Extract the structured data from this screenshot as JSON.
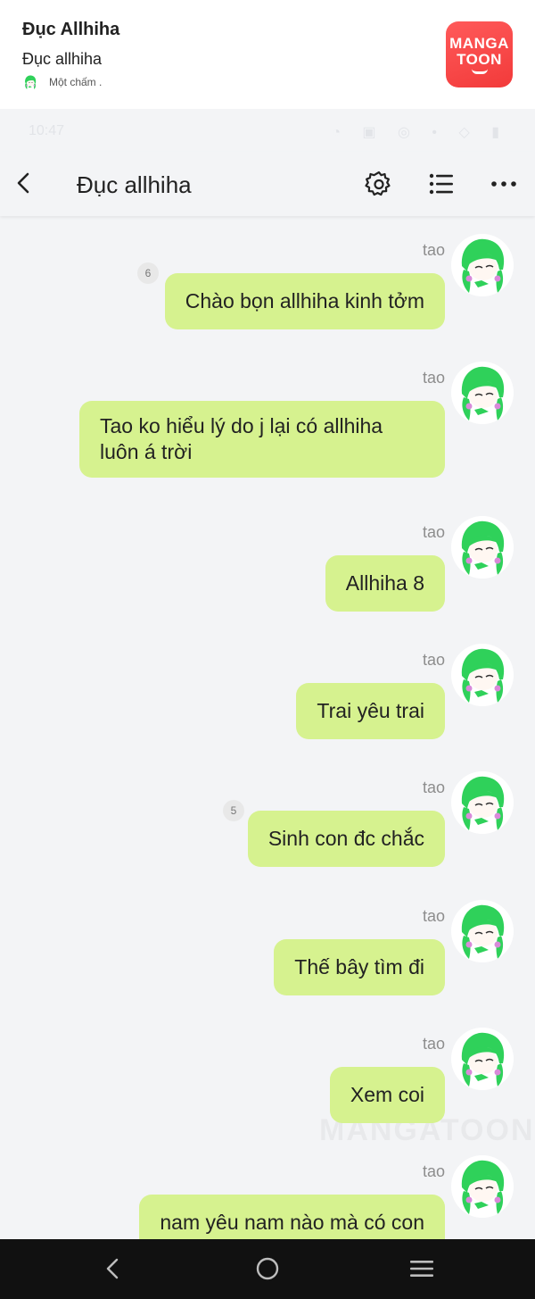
{
  "story": {
    "title": "Đục Allhiha",
    "subtitle": "Đục allhiha",
    "meta": "Một chấm ."
  },
  "logo": {
    "line1": "MANGA",
    "line2": "TOON"
  },
  "status_bar": {
    "time": "10:47",
    "icons": "◔ ▣ ◎ • ◇ ▮"
  },
  "app_bar": {
    "title": "Đục allhiha"
  },
  "watermark": "MANGATOON",
  "messages": [
    {
      "sender": "tao",
      "text": "Chào bọn allhiha kinh tởm",
      "badge": "6"
    },
    {
      "sender": "tao",
      "text": "Tao ko hiểu lý do j lại có allhiha\nluôn á trời",
      "badge": ""
    },
    {
      "sender": "tao",
      "text": "Allhiha 8",
      "badge": ""
    },
    {
      "sender": "tao",
      "text": "Trai yêu trai",
      "badge": ""
    },
    {
      "sender": "tao",
      "text": "Sinh con đc chắc",
      "badge": "5"
    },
    {
      "sender": "tao",
      "text": "Thế bây tìm đi",
      "badge": ""
    },
    {
      "sender": "tao",
      "text": "Xem coi",
      "badge": ""
    },
    {
      "sender": "tao",
      "text": "nam yêu nam nào mà có con",
      "badge": ""
    }
  ],
  "colors": {
    "bubble": "#d6f28f",
    "background": "#f3f4f6",
    "avatar_hair": "#2fd15a",
    "logo": "#f23a3a",
    "nav_bar": "#111111"
  },
  "icons": [
    "back-icon",
    "gear-icon",
    "list-icon",
    "more-icon",
    "nav-back-icon",
    "nav-home-icon",
    "nav-recents-icon"
  ]
}
